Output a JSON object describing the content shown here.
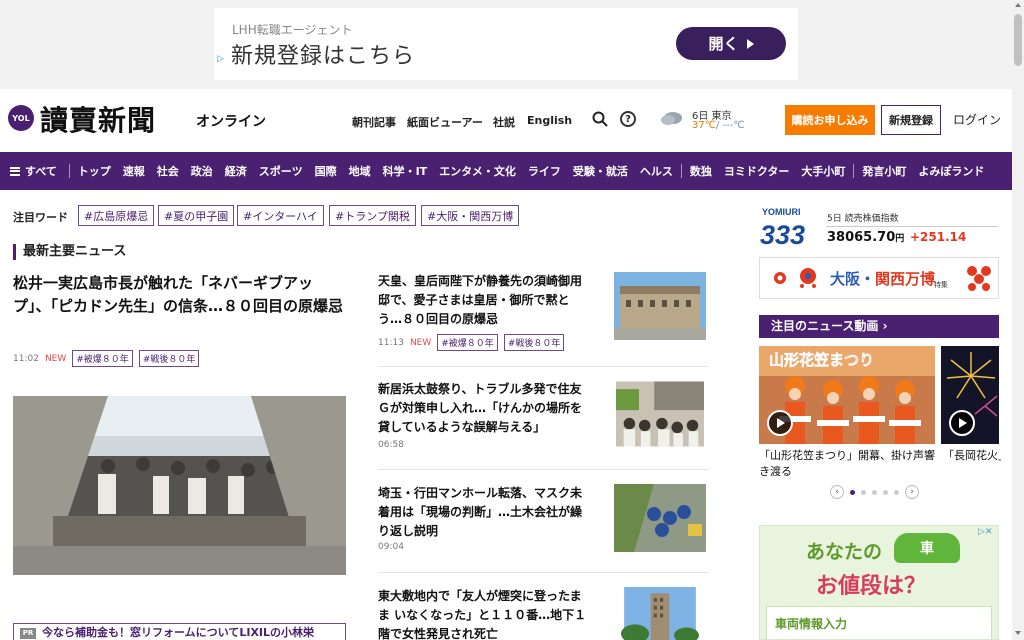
{
  "ad_top": {
    "small_text": "LHH転職エージェント",
    "main_text": "新規登録はこちら",
    "cta_label": "開く"
  },
  "header": {
    "logo_badge": "YOL",
    "logo_title": "讀賣新聞",
    "logo_sub": "オンライン",
    "links": [
      "朝刊記事",
      "紙面ビューアー",
      "社説",
      "English"
    ],
    "weather_location": "6日 東京",
    "weather_high": "37℃",
    "weather_low": "/ ---℃",
    "subscribe_label": "購読お申し込み",
    "register_label": "新規登録",
    "login_label": "ログイン"
  },
  "nav": {
    "all_label": "すべて",
    "items_a": [
      "トップ",
      "速報",
      "社会",
      "政治",
      "経済",
      "スポーツ",
      "国際",
      "地域",
      "科学・IT",
      "エンタメ・文化",
      "ライフ",
      "受験・就活",
      "ヘルス"
    ],
    "items_b": [
      "数独",
      "ヨミドクター",
      "大手小町"
    ],
    "items_c": [
      "発言小町",
      "よみぽランド"
    ]
  },
  "tags": {
    "label": "注目ワード",
    "items": [
      "#広島原爆忌",
      "#夏の甲子園",
      "#インターハイ",
      "#トランプ関税",
      "#大阪・関西万博"
    ]
  },
  "main": {
    "section_title": "最新主要ニュース",
    "lead": {
      "title": "松井一実広島市長が触れた「ネバーギブアップ」、「ピカドン先生」の信条…８０回目の原爆忌",
      "time": "11:02",
      "new": "NEW",
      "tags": [
        "#被爆８０年",
        "#戦後８０年"
      ]
    },
    "articles": [
      {
        "title": "天皇、皇后両陛下が静養先の須崎御用邸で、愛子さまは皇居・御所で黙とう…８０回目の原爆忌",
        "time": "11:13",
        "new": "NEW",
        "tags": [
          "#被爆８０年",
          "#戦後８０年"
        ]
      },
      {
        "title": "新居浜太鼓祭り、トラブル多発で住友Ｇが対策申し入れ…「けんかの場所を貸しているような誤解与える」",
        "time": "06:58"
      },
      {
        "title": "埼玉・行田マンホール転落、マスク未着用は「現場の判断」…土木会社が繰り返し説明",
        "time": "09:04"
      },
      {
        "title": "東大敷地内で「友人が煙突に登ったまま いなくなった」と１１０番…地下１階で女性発見され死亡"
      }
    ],
    "bottom_ad": "今なら補助金も！窓リフォームについてLIXILの小林栄"
  },
  "sidebar": {
    "index_logo_text": "YOMIURI",
    "index_logo_num": "333",
    "index_date": "5日 読売株価指数",
    "index_value": "38065.70",
    "index_unit": "円",
    "index_change": "+251.14",
    "expo_osaka": "大阪・",
    "expo_kansai": "関西万博",
    "expo_sub": "特集",
    "video_head": "注目のニュース動画",
    "videos": [
      {
        "caption": "「山形花笠まつり」開幕、掛け声響き渡る",
        "overlay": "山形花笠まつり"
      },
      {
        "caption": "「長岡花火」"
      }
    ],
    "car_ad_line1": "あなたの",
    "car_ad_icon": "車",
    "car_ad_line2": "お値段は？",
    "car_ad_input": "車両情報入力"
  },
  "colors": {
    "brand": "#4a2170",
    "accent_orange": "#f77b00",
    "news_red": "#e04a4a",
    "index_red": "#e0391f"
  }
}
